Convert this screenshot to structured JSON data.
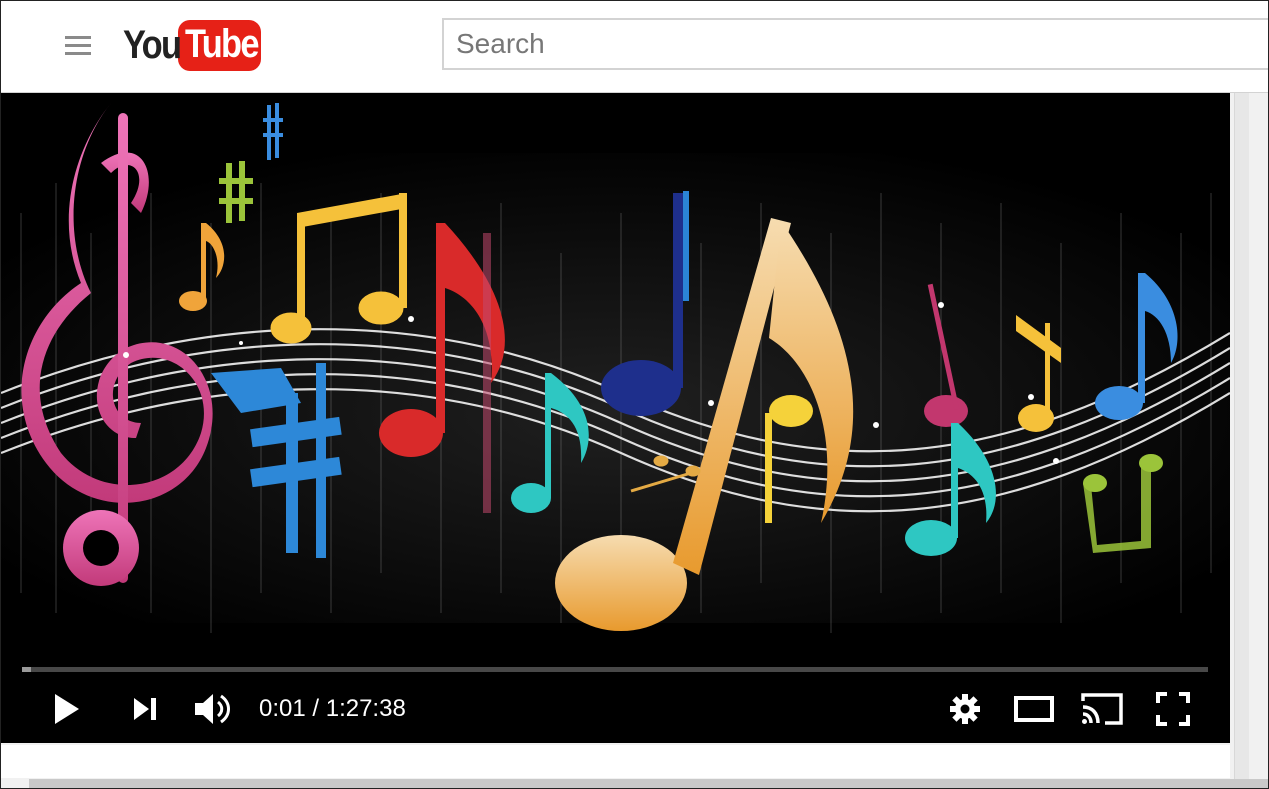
{
  "app": {
    "logo_you": "You",
    "logo_tube": "Tube",
    "brand_color": "#e62117"
  },
  "header": {
    "menu_icon": "hamburger-icon",
    "search_placeholder": "Search"
  },
  "player": {
    "current_time": "0:01",
    "duration": "1:27:38",
    "time_display": "0:01 / 1:27:38",
    "progress_fraction": 0.008,
    "controls": {
      "play_icon": "play-icon",
      "next_icon": "next-icon",
      "volume_icon": "volume-icon",
      "settings_icon": "gear-icon",
      "theater_icon": "theater-mode-icon",
      "cast_icon": "cast-icon",
      "fullscreen_icon": "fullscreen-icon"
    }
  }
}
